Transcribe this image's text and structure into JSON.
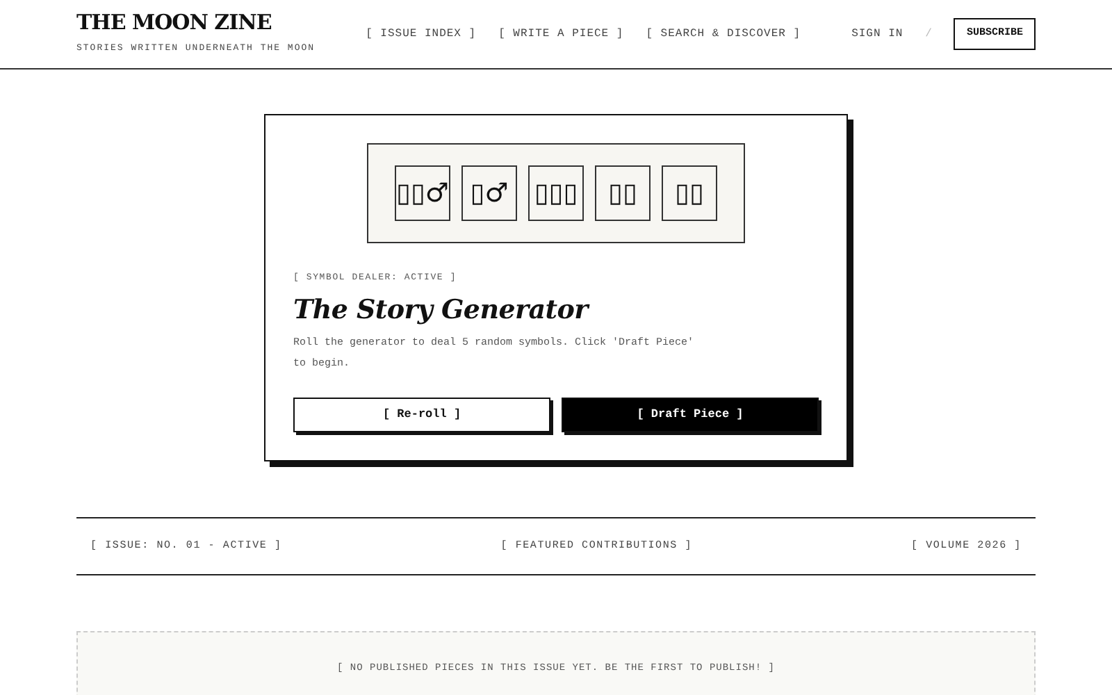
{
  "header": {
    "logo": "THE MOON ZINE",
    "tagline": "STORIES WRITTEN UNDERNEATH THE MOON",
    "nav": [
      "[ ISSUE INDEX ]",
      "[ WRITE A PIECE ]",
      "[ SEARCH & DISCOVER ]"
    ],
    "sign_in": "SIGN IN",
    "separator": "/",
    "subscribe": "SUBSCRIBE"
  },
  "generator": {
    "symbols": [
      "▯▯♂",
      "▯♂",
      "▯▯▯",
      "▯▯",
      "▯▯"
    ],
    "status": "[ SYMBOL DEALER: ACTIVE ]",
    "title": "The Story Generator",
    "description": "Roll the generator to deal 5 random symbols. Click 'Draft Piece' to begin.",
    "buttons": [
      {
        "label": "[ Re-roll ]",
        "kind": "outline"
      },
      {
        "label": "[ Draft Piece ]",
        "kind": "solid"
      }
    ]
  },
  "issue_bar": [
    "[ ISSUE: NO. 01 - ACTIVE ]",
    "[ FEATURED CONTRIBUTIONS ]",
    "[ VOLUME 2026 ]"
  ],
  "empty_state": "[ NO PUBLISHED PIECES IN THIS ISSUE YET. BE THE FIRST TO PUBLISH! ]"
}
